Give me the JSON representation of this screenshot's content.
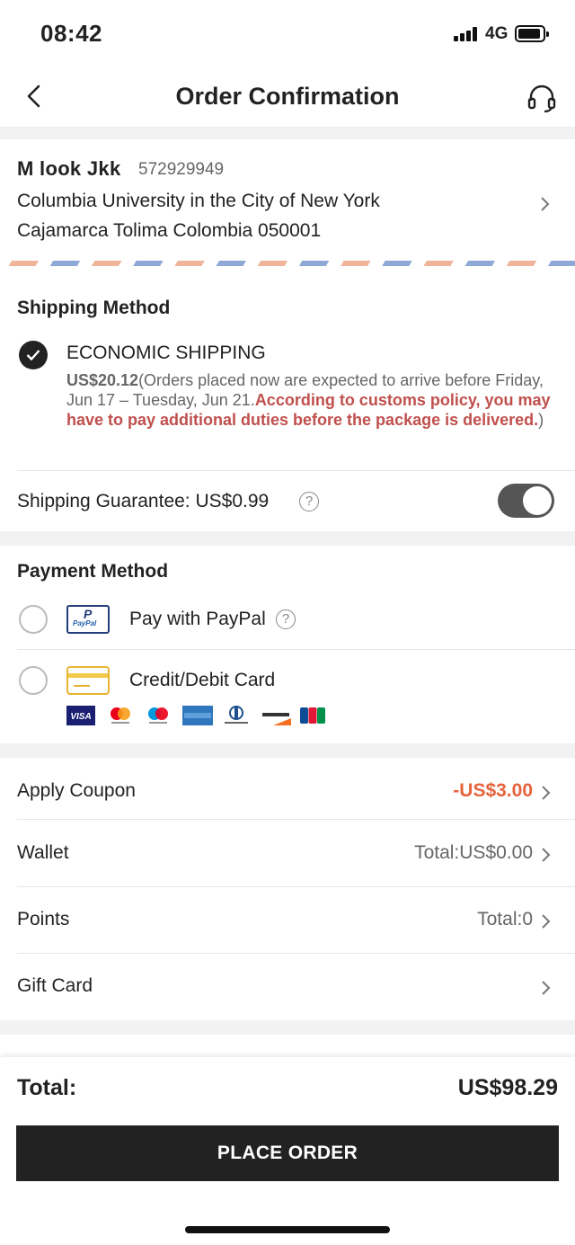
{
  "status_bar": {
    "time": "08:42",
    "network": "4G"
  },
  "header": {
    "title": "Order Confirmation",
    "back_icon": "chevron-left-icon",
    "support_icon": "headset-icon"
  },
  "address": {
    "name": "M  look  Jkk",
    "phone": "572929949",
    "line1": "Columbia University in the City of New York",
    "line2": "Cajamarca Tolima Colombia 050001"
  },
  "shipping": {
    "title": "Shipping Method",
    "method_name": "ECONOMIC SHIPPING",
    "price": "US$20.12",
    "desc_open": "(Orders placed now are expected to arrive before Friday, Jun 17 – Tuesday, Jun 21.",
    "warning": "According to customs policy, you may have to pay additional duties before the package is delivered.",
    "desc_close": ")",
    "guarantee_label": "Shipping Guarantee: US$0.99",
    "guarantee_enabled": true
  },
  "payment": {
    "title": "Payment Method",
    "paypal_label": "Pay with PayPal",
    "paypal_logo_text": "PayPal",
    "card_label": "Credit/Debit Card",
    "brands": [
      "VISA",
      "Mastercard",
      "Maestro",
      "American Express",
      "Diners Club",
      "DISCOVER",
      "JCB"
    ]
  },
  "discounts": {
    "coupon_label": "Apply Coupon",
    "coupon_value": "-US$3.00",
    "wallet_label": "Wallet",
    "wallet_value": "Total:US$0.00",
    "points_label": "Points",
    "points_value": "Total:0",
    "giftcard_label": "Gift Card"
  },
  "footer": {
    "total_label": "Total:",
    "total_value": "US$98.29",
    "place_order": "PLACE ORDER"
  },
  "colors": {
    "accent_red": "#e5633c",
    "warning_red": "#c0504d",
    "button_dark": "#222222"
  }
}
